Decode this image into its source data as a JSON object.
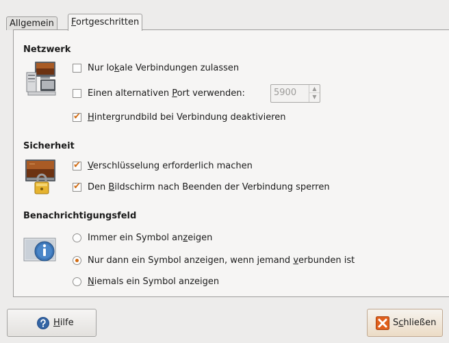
{
  "tabs": [
    {
      "label": "Allgemein",
      "active": false
    },
    {
      "label": "Fortgeschritten",
      "underline_char": "F",
      "rest": "ortgeschritten",
      "active": true
    }
  ],
  "sections": {
    "netzwerk": {
      "title": "Netzwerk",
      "icon": "network-computers-icon",
      "options": [
        {
          "pre": "Nur lo",
          "u": "k",
          "post": "ale Verbindungen zulassen",
          "checked": false
        },
        {
          "pre": "Einen alternativen ",
          "u": "P",
          "post": "ort verwenden:",
          "checked": false
        },
        {
          "pre": "",
          "u": "H",
          "post": "intergrundbild bei Verbindung deaktivieren",
          "checked": true
        }
      ],
      "port": {
        "value": "5900",
        "enabled": false
      }
    },
    "sicherheit": {
      "title": "Sicherheit",
      "icon": "screen-lock-icon",
      "options": [
        {
          "pre": "",
          "u": "V",
          "post": "erschlüsselung erforderlich machen",
          "checked": true
        },
        {
          "pre": "Den ",
          "u": "B",
          "post": "ildschirm nach Beenden der Verbindung sperren",
          "checked": true
        }
      ]
    },
    "benachrichtigung": {
      "title": "Benachrichtigungsfeld",
      "icon": "info-icon",
      "options": [
        {
          "pre": "Immer ein Symbol an",
          "u": "z",
          "post": "eigen",
          "selected": false
        },
        {
          "pre": "Nur dann ein Symbol anzeigen, wenn jemand ",
          "u": "v",
          "post": "erbunden ist",
          "selected": true
        },
        {
          "pre": "",
          "u": "N",
          "post": "iemals ein Symbol anzeigen",
          "selected": false
        }
      ]
    }
  },
  "footer": {
    "help": {
      "u": "H",
      "post": "ilfe",
      "icon": "help-icon"
    },
    "close": {
      "pre": "S",
      "u": "c",
      "post": "hließen",
      "icon": "close-icon"
    }
  },
  "colors": {
    "accent": "#d1690e",
    "panel": "#f6f5f4",
    "window": "#edeceb"
  }
}
